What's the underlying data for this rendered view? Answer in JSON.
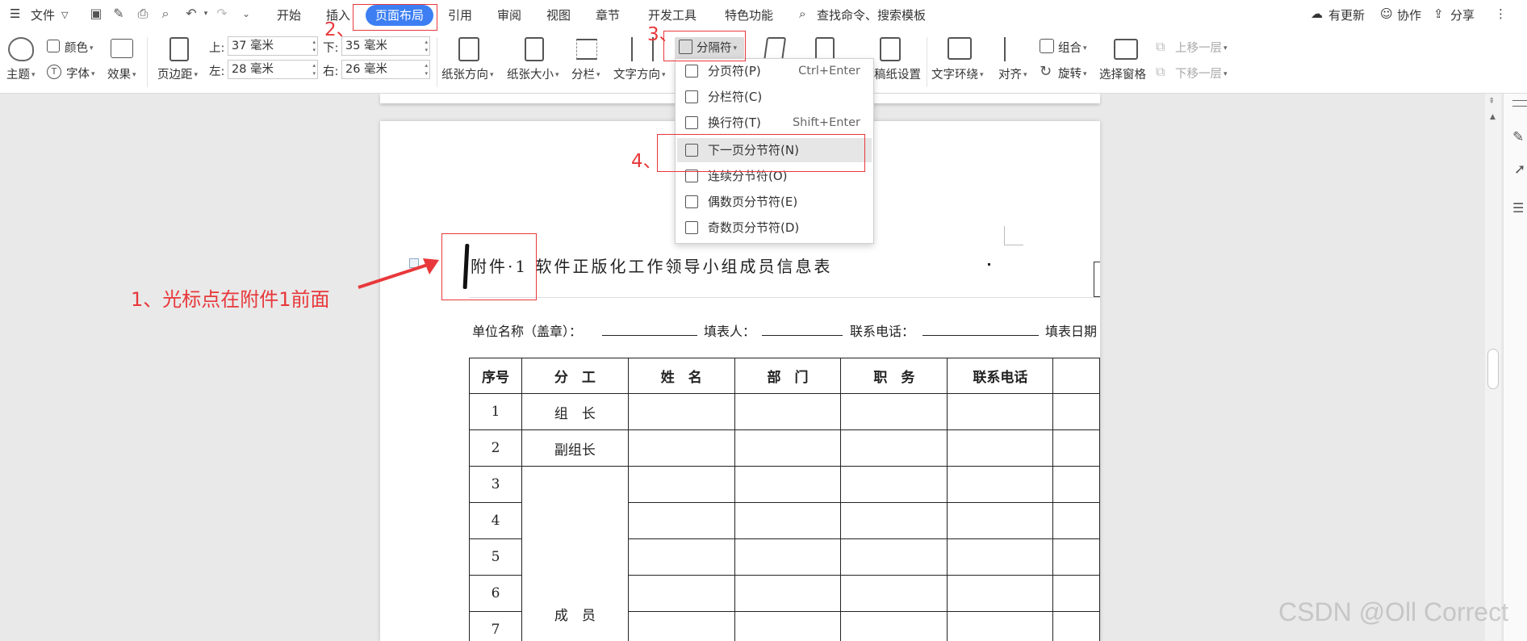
{
  "menu": {
    "file": "文件",
    "tabs": [
      "开始",
      "插入",
      "页面布局",
      "引用",
      "审阅",
      "视图",
      "章节",
      "开发工具",
      "特色功能"
    ],
    "search": "查找命令、搜索模板",
    "right": [
      "有更新",
      "协作",
      "分享"
    ]
  },
  "ribbon": {
    "theme": "主题",
    "color": "颜色",
    "font": "字体",
    "effect": "效果",
    "margins": "页边距",
    "margin_top_label": "上:",
    "margin_top": "37 毫米",
    "margin_bottom_label": "下:",
    "margin_bottom": "35 毫米",
    "margin_left_label": "左:",
    "margin_left": "28 毫米",
    "margin_right_label": "右:",
    "margin_right": "26 毫米",
    "orientation": "纸张方向",
    "size": "纸张大小",
    "columns": "分栏",
    "text_direction": "文字方向",
    "breaks": "分隔符",
    "paper_settings": "稿纸设置",
    "wrap_text": "文字环绕",
    "align": "对齐",
    "group": "组合",
    "rotate": "旋转",
    "selection_pane": "选择窗格",
    "bring_forward": "上移一层",
    "send_backward": "下移一层"
  },
  "breaks_menu": [
    {
      "label": "分页符(P)",
      "shortcut": "Ctrl+Enter"
    },
    {
      "label": "分栏符(C)",
      "shortcut": ""
    },
    {
      "label": "换行符(T)",
      "shortcut": "Shift+Enter"
    },
    {
      "label": "下一页分节符(N)",
      "shortcut": "",
      "highlighted": true
    },
    {
      "label": "连续分节符(O)",
      "shortcut": ""
    },
    {
      "label": "偶数页分节符(E)",
      "shortcut": ""
    },
    {
      "label": "奇数页分节符(D)",
      "shortcut": ""
    }
  ],
  "document": {
    "title": "附件·1 软件正版化工作领导小组成员信息表",
    "form_line": {
      "unit": "单位名称（盖章）：",
      "filler": "填表人：",
      "phone": "联系电话：",
      "date": "填表日期"
    },
    "table": {
      "headers": [
        "序号",
        "分　工",
        "姓　名",
        "部　门",
        "职　务",
        "联系电话",
        ""
      ],
      "rows": [
        {
          "no": "1",
          "role": "组　长"
        },
        {
          "no": "2",
          "role": "副组长"
        },
        {
          "no": "3",
          "role": ""
        },
        {
          "no": "4",
          "role": ""
        },
        {
          "no": "5",
          "role": ""
        },
        {
          "no": "6",
          "role": ""
        },
        {
          "no": "7",
          "role": ""
        }
      ],
      "member_role": "成　员"
    }
  },
  "annotations": {
    "step1": "1、光标点在附件1前面",
    "step2": "2、",
    "step3": "3、",
    "step4": "4、"
  },
  "watermark": "CSDN @Oll Correct",
  "colors": {
    "accent": "#3d7ff3",
    "annotation": "#e8383b"
  }
}
